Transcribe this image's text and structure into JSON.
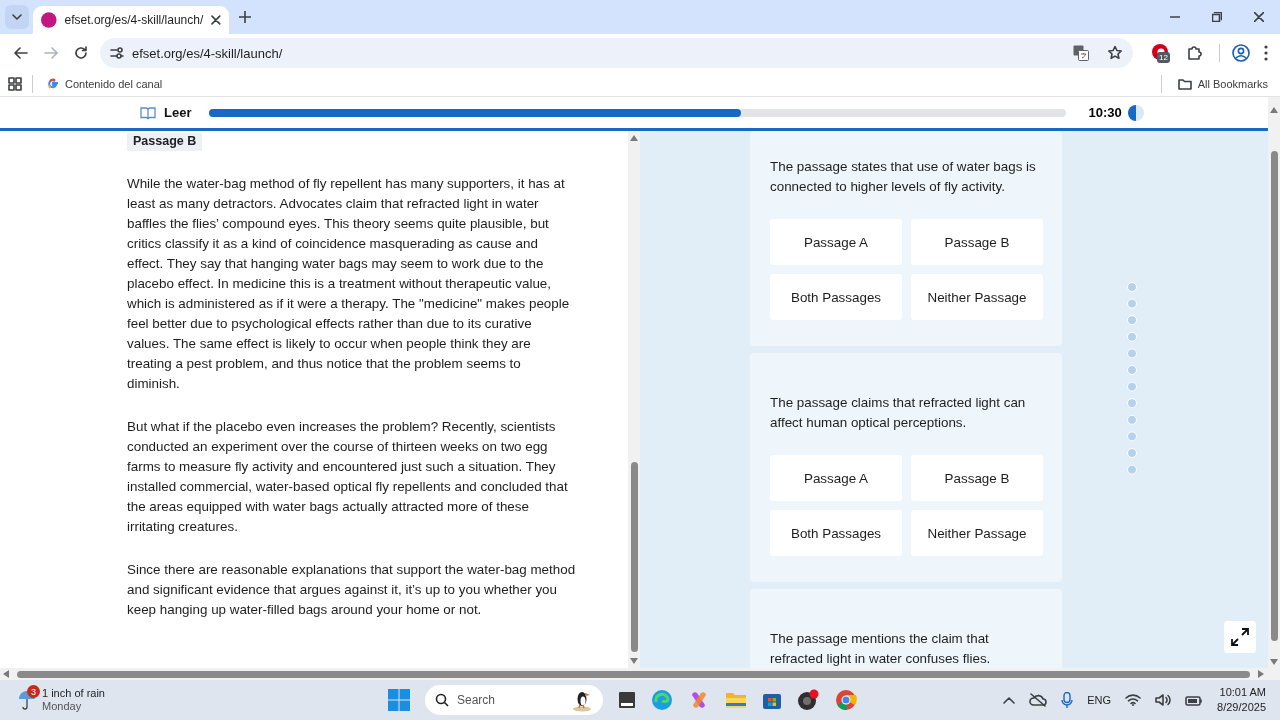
{
  "browser": {
    "tab_title": "efset.org/es/4-skill/launch/",
    "url": "efset.org/es/4-skill/launch/",
    "extension_badge": "12",
    "bookmarks": [
      {
        "label": "Contenido del canal"
      }
    ],
    "all_bookmarks": "All Bookmarks"
  },
  "header": {
    "section": "Leer",
    "progress": {
      "level": 0.62
    },
    "timer": {
      "reading": "10:30",
      "level": 0.5
    }
  },
  "passage": {
    "label": "Passage B",
    "paragraphs": [
      "While the water-bag method of fly repellent has many supporters, it has at least as many detractors. Advocates claim that refracted light in water baffles the flies’ compound eyes. This theory seems quite plausible, but critics classify it as a kind of coincidence masquerading as cause and effect. They say that hanging water bags may seem to work due to the placebo effect. In medicine this is a treatment without therapeutic value, which is administered as if it were a therapy. The \"medicine\" makes people feel better due to psychological effects rather than due to its curative values. The same effect is likely to occur when people think they are treating a pest problem, and thus notice that the problem seems to diminish.",
      "But what if the placebo even increases the problem? Recently, scientists conducted an experiment over the course of thirteen weeks on two egg farms to measure fly activity and encountered just such a situation. They installed commercial, water-based optical fly repellents and concluded that the areas equipped with water bags actually attracted more of these irritating creatures.",
      "Since there are reasonable explanations that support the water-bag method and significant evidence that argues against it, it’s up to you whether you keep hanging up water-filled bags around your home or not."
    ]
  },
  "questions": [
    {
      "statement": "The passage states that use of water bags is connected to higher levels of fly activity.",
      "options": [
        {
          "label": "Passage A",
          "selected": false
        },
        {
          "label": "Passage B",
          "selected": false
        },
        {
          "label": "Both Passages",
          "selected": false
        },
        {
          "label": "Neither Passage",
          "selected": false
        }
      ]
    },
    {
      "statement": "The passage claims that refracted light can affect human optical perceptions.",
      "options": [
        {
          "label": "Passage A",
          "selected": false
        },
        {
          "label": "Passage B",
          "selected": false
        },
        {
          "label": "Both Passages",
          "selected": false
        },
        {
          "label": "Neither Passage",
          "selected": false
        }
      ]
    },
    {
      "statement": "The passage mentions the claim that refracted light in water confuses flies."
    }
  ],
  "taskbar": {
    "weather": {
      "badge": "3",
      "title": "1 inch of rain",
      "subtitle": "Monday"
    },
    "search_placeholder": "Search",
    "language": "ENG",
    "time": "10:01 AM",
    "date": "8/29/2025"
  }
}
